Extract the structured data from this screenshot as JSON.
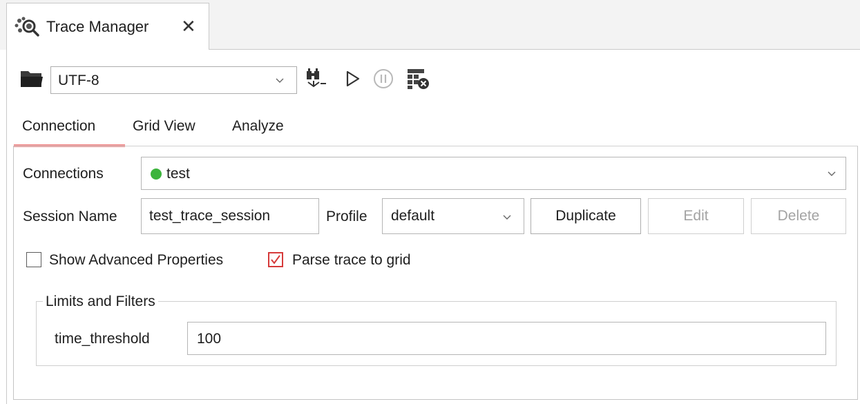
{
  "window_tab": {
    "title": "Trace Manager",
    "icon": "trace-magnifier-icon",
    "close_symbol": "✕"
  },
  "toolbar": {
    "encoding_value": "UTF-8",
    "icons": [
      "folder-open-icon",
      "binoculars-icon",
      "play-icon",
      "pause-icon",
      "clear-grid-icon"
    ]
  },
  "tabs": [
    "Connection",
    "Grid View",
    "Analyze"
  ],
  "active_tab": "Connection",
  "connection": {
    "connections_label": "Connections",
    "connection_value": "test",
    "connection_status_color": "#3cb43c",
    "session_name_label": "Session Name",
    "session_name_value": "test_trace_session",
    "profile_label": "Profile",
    "profile_value": "default",
    "duplicate_label": "Duplicate",
    "edit_label": "Edit",
    "delete_label": "Delete",
    "show_advanced_label": "Show Advanced Properties",
    "show_advanced_checked": false,
    "parse_trace_label": "Parse trace to grid",
    "parse_trace_checked": true
  },
  "limits": {
    "group_title": "Limits and Filters",
    "time_threshold_label": "time_threshold",
    "time_threshold_value": "100"
  },
  "colors": {
    "active_tab_indicator": "#ee8a8a",
    "checkbox_checked": "#d63a3a"
  }
}
